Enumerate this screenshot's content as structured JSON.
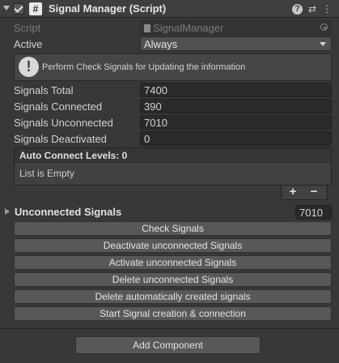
{
  "header": {
    "title": "Signal Manager (Script)",
    "script_icon": "#",
    "icons": [
      "help-icon",
      "preset-icon",
      "more-icon"
    ],
    "help_glyph": "?",
    "preset_glyph": "⇄",
    "more_glyph": "⋮"
  },
  "script_field": {
    "label": "Script",
    "value": "SignalManager"
  },
  "active": {
    "label": "Active",
    "value": "Always"
  },
  "help": {
    "icon": "!",
    "text": "Perform Check Signals for Updating the information"
  },
  "stats": [
    {
      "label": "Signals Total",
      "value": "7400"
    },
    {
      "label": "Signals Connected",
      "value": "390"
    },
    {
      "label": "Signals Unconnected",
      "value": "7010"
    },
    {
      "label": "Signals Deactivated",
      "value": "0"
    }
  ],
  "list": {
    "header": "Auto Connect Levels: 0",
    "empty_text": "List is Empty",
    "add_label": "+",
    "remove_label": "−"
  },
  "unconnected": {
    "label": "Unconnected Signals",
    "value": "7010"
  },
  "buttons": [
    "Check Signals",
    "Deactivate unconnected Signals",
    "Activate unconnected Signals",
    "Delete unconnected Signals",
    "Delete automatically created signals",
    "Start Signal creation & connection"
  ],
  "add_component": "Add Component",
  "colors": {
    "background": "#383838",
    "field": "#2a2a2a",
    "button": "#585858"
  }
}
